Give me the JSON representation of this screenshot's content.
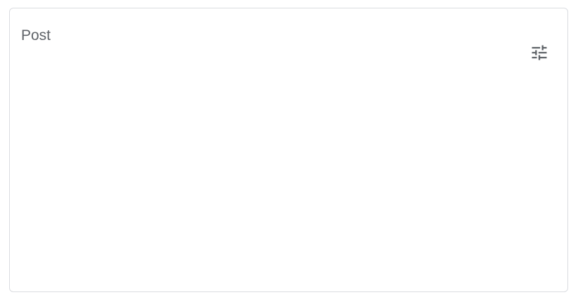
{
  "card": {
    "title": "Post",
    "filter_icon": "tune-icon"
  },
  "colors": {
    "title": "#5f6368",
    "icon": "#5f6368",
    "border": "#dadce0",
    "background": "#ffffff"
  }
}
